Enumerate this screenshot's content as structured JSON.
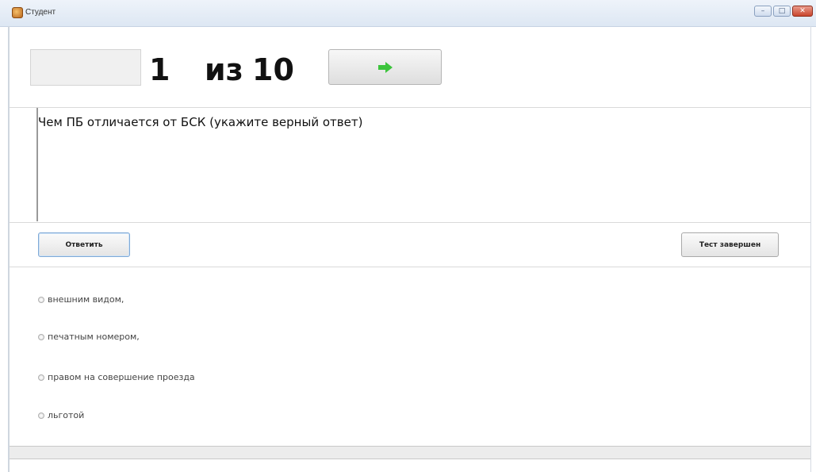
{
  "window": {
    "title": "Студент",
    "controls": {
      "minimize": "–",
      "maximize": "□",
      "close": "✕"
    }
  },
  "header": {
    "current": "1",
    "of": "из",
    "total": "10",
    "next_icon": "arrow-right-icon",
    "next_icon_color": "#3cc43c"
  },
  "question": {
    "text": "Чем ПБ отличается от БСК (укажите верный ответ)"
  },
  "actions": {
    "answer_label": "Ответить",
    "finish_label": "Тест завершен"
  },
  "options": [
    {
      "label": "внешним видом,",
      "selected": false
    },
    {
      "label": "печатным номером,",
      "selected": false
    },
    {
      "label": "правом на совершение проезда",
      "selected": false
    },
    {
      "label": "льготой",
      "selected": false
    }
  ]
}
